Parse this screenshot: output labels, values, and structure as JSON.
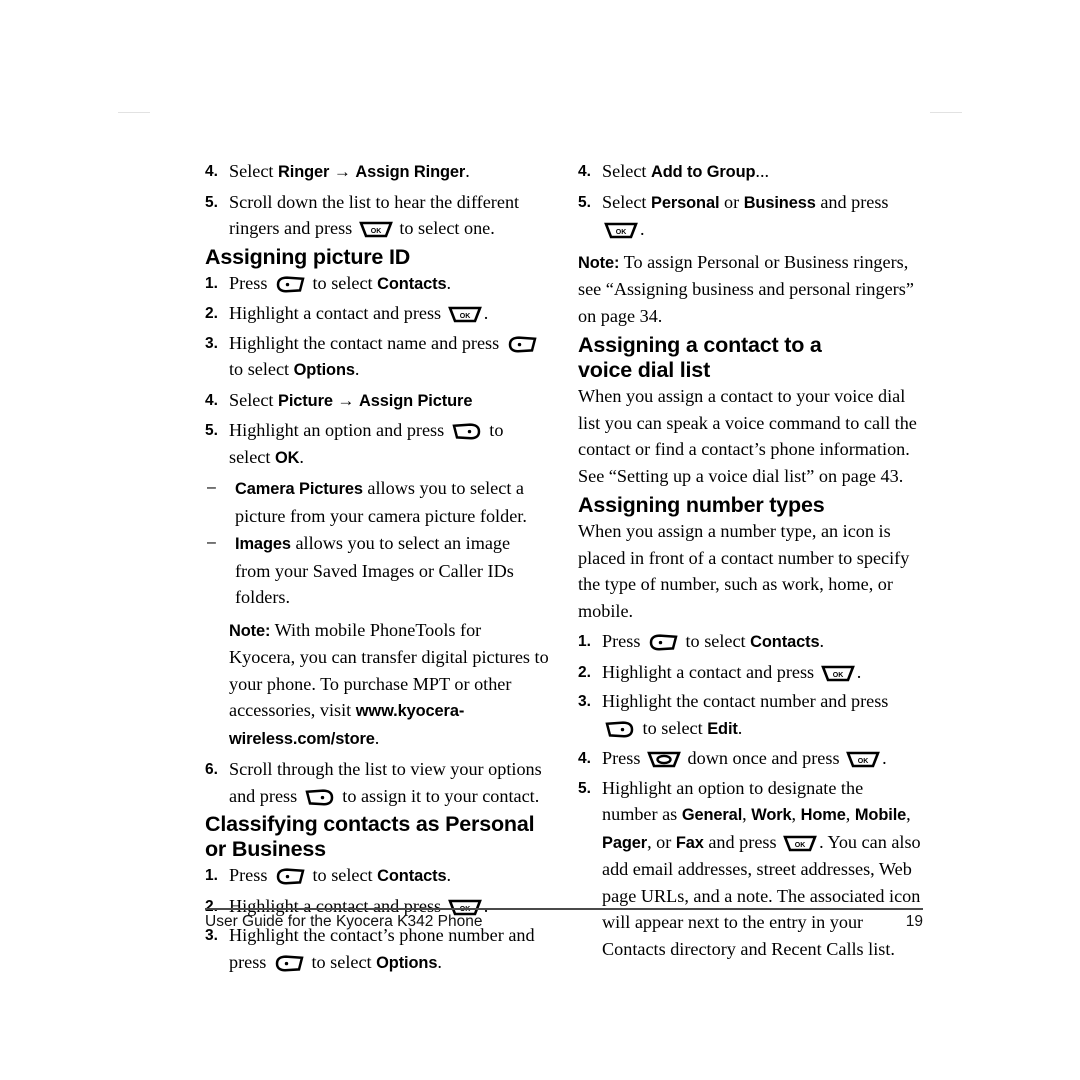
{
  "document": {
    "footer_text": "User Guide for the Kyocera K342 Phone",
    "page_number": "19"
  },
  "icons": {
    "ok_key": "ok-key-icon",
    "left_softkey": "left-softkey-icon",
    "right_softkey": "right-softkey-icon",
    "navigation_key": "navigation-key-icon",
    "arrow": "→",
    "dash": "–"
  },
  "left_column": {
    "continued_steps": [
      {
        "num": "4.",
        "parts": [
          {
            "t": "text",
            "v": "Select "
          },
          {
            "t": "ui",
            "v": "Ringer"
          },
          {
            "t": "text",
            "v": " "
          },
          {
            "t": "arrow",
            "v": "→"
          },
          {
            "t": "text",
            "v": " "
          },
          {
            "t": "ui",
            "v": "Assign Ringer"
          },
          {
            "t": "text",
            "v": "."
          }
        ]
      },
      {
        "num": "5.",
        "parts": [
          {
            "t": "text",
            "v": "Scroll down the list to hear the different ringers and press "
          },
          {
            "t": "icon",
            "v": "ok_key"
          },
          {
            "t": "text",
            "v": " to select one."
          }
        ]
      }
    ],
    "section_picture_id": {
      "heading": "Assigning picture ID",
      "steps": [
        {
          "num": "1.",
          "parts": [
            {
              "t": "text",
              "v": "Press "
            },
            {
              "t": "icon",
              "v": "left_softkey"
            },
            {
              "t": "text",
              "v": " to select "
            },
            {
              "t": "ui",
              "v": "Contacts"
            },
            {
              "t": "text",
              "v": "."
            }
          ]
        },
        {
          "num": "2.",
          "parts": [
            {
              "t": "text",
              "v": "Highlight a contact and press "
            },
            {
              "t": "icon",
              "v": "ok_key"
            },
            {
              "t": "text",
              "v": "."
            }
          ]
        },
        {
          "num": "3.",
          "parts": [
            {
              "t": "text",
              "v": "Highlight the contact name and press "
            },
            {
              "t": "icon",
              "v": "left_softkey"
            },
            {
              "t": "text",
              "v": " to select "
            },
            {
              "t": "ui",
              "v": "Options"
            },
            {
              "t": "text",
              "v": "."
            }
          ]
        },
        {
          "num": "4.",
          "parts": [
            {
              "t": "text",
              "v": "Select "
            },
            {
              "t": "ui",
              "v": "Picture"
            },
            {
              "t": "text",
              "v": " "
            },
            {
              "t": "arrow",
              "v": "→"
            },
            {
              "t": "text",
              "v": " "
            },
            {
              "t": "ui",
              "v": "Assign Picture"
            }
          ]
        },
        {
          "num": "5.",
          "parts": [
            {
              "t": "text",
              "v": "Highlight an option and press "
            },
            {
              "t": "icon",
              "v": "right_softkey"
            },
            {
              "t": "text",
              "v": " to select "
            },
            {
              "t": "ui",
              "v": "OK"
            },
            {
              "t": "text",
              "v": "."
            }
          ]
        }
      ],
      "sub_items": [
        {
          "dash": "–",
          "parts": [
            {
              "t": "ui",
              "v": "Camera Pictures"
            },
            {
              "t": "text",
              "v": " allows you to select a picture from your camera picture folder."
            }
          ]
        },
        {
          "dash": "–",
          "parts": [
            {
              "t": "ui",
              "v": "Images"
            },
            {
              "t": "text",
              "v": " allows you to select an image from your Saved Images or Caller IDs folders."
            }
          ]
        }
      ],
      "note": {
        "label": "Note:",
        "parts": [
          {
            "t": "text",
            "v": "  With mobile PhoneTools for Kyocera, you can transfer digital pictures to your phone. To purchase MPT or other accessories, visit "
          },
          {
            "t": "ui",
            "v": "www.kyocera-wireless.com/store"
          },
          {
            "t": "text",
            "v": "."
          }
        ]
      },
      "final_step": {
        "num": "6.",
        "parts": [
          {
            "t": "text",
            "v": "Scroll through the list to view your options and press "
          },
          {
            "t": "icon",
            "v": "right_softkey"
          },
          {
            "t": "text",
            "v": " to assign it to your contact."
          }
        ]
      }
    },
    "section_classifying": {
      "heading": "Classifying contacts as Personal or Business",
      "steps": [
        {
          "num": "1.",
          "parts": [
            {
              "t": "text",
              "v": "Press "
            },
            {
              "t": "icon",
              "v": "left_softkey"
            },
            {
              "t": "text",
              "v": " to select "
            },
            {
              "t": "ui",
              "v": "Contacts"
            },
            {
              "t": "text",
              "v": "."
            }
          ]
        },
        {
          "num": "2.",
          "parts": [
            {
              "t": "text",
              "v": "Highlight a contact and press "
            },
            {
              "t": "icon",
              "v": "ok_key"
            },
            {
              "t": "text",
              "v": "."
            }
          ]
        },
        {
          "num": "3.",
          "parts": [
            {
              "t": "text",
              "v": "Highlight the contact’s phone number and press "
            },
            {
              "t": "icon",
              "v": "left_softkey"
            },
            {
              "t": "text",
              "v": " to select "
            },
            {
              "t": "ui",
              "v": "Options"
            },
            {
              "t": "text",
              "v": "."
            }
          ]
        }
      ]
    }
  },
  "right_column": {
    "continued_steps": [
      {
        "num": "4.",
        "parts": [
          {
            "t": "text",
            "v": "Select "
          },
          {
            "t": "ui",
            "v": "Add to Group"
          },
          {
            "t": "text",
            "v": "..."
          }
        ]
      },
      {
        "num": "5.",
        "parts": [
          {
            "t": "text",
            "v": "Select "
          },
          {
            "t": "ui",
            "v": "Personal"
          },
          {
            "t": "text",
            "v": " or "
          },
          {
            "t": "ui",
            "v": "Business"
          },
          {
            "t": "text",
            "v": " and press "
          },
          {
            "t": "icon",
            "v": "ok_key"
          },
          {
            "t": "text",
            "v": "."
          }
        ]
      }
    ],
    "note": {
      "label": "Note:",
      "parts": [
        {
          "t": "text",
          "v": "  To assign Personal or Business ringers, see “Assigning business and personal ringers” on page 34."
        }
      ]
    },
    "section_voice_dial": {
      "heading_line1": "Assigning a contact to a",
      "heading_line2": "voice dial list",
      "paragraph": "When you assign a contact to your voice dial list you can speak a voice command to call the contact or find a contact’s phone information. See “Setting up a voice dial list” on page 43."
    },
    "section_number_types": {
      "heading": "Assigning number types",
      "paragraph": "When you assign a number type, an icon is placed in front of a contact number to specify the type of number, such as work, home, or mobile.",
      "steps": [
        {
          "num": "1.",
          "parts": [
            {
              "t": "text",
              "v": "Press "
            },
            {
              "t": "icon",
              "v": "left_softkey"
            },
            {
              "t": "text",
              "v": " to select "
            },
            {
              "t": "ui",
              "v": "Contacts"
            },
            {
              "t": "text",
              "v": "."
            }
          ]
        },
        {
          "num": "2.",
          "parts": [
            {
              "t": "text",
              "v": "Highlight a contact and press "
            },
            {
              "t": "icon",
              "v": "ok_key"
            },
            {
              "t": "text",
              "v": "."
            }
          ]
        },
        {
          "num": "3.",
          "parts": [
            {
              "t": "text",
              "v": "Highlight the contact number and press "
            },
            {
              "t": "icon",
              "v": "right_softkey"
            },
            {
              "t": "text",
              "v": " to select "
            },
            {
              "t": "ui",
              "v": "Edit"
            },
            {
              "t": "text",
              "v": "."
            }
          ]
        },
        {
          "num": "4.",
          "parts": [
            {
              "t": "text",
              "v": "Press "
            },
            {
              "t": "icon",
              "v": "navigation_key"
            },
            {
              "t": "text",
              "v": " down once and press "
            },
            {
              "t": "icon",
              "v": "ok_key"
            },
            {
              "t": "text",
              "v": "."
            }
          ]
        },
        {
          "num": "5.",
          "parts": [
            {
              "t": "text",
              "v": "Highlight an option to designate the number as "
            },
            {
              "t": "ui",
              "v": "General"
            },
            {
              "t": "text",
              "v": ", "
            },
            {
              "t": "ui",
              "v": "Work"
            },
            {
              "t": "text",
              "v": ", "
            },
            {
              "t": "ui",
              "v": "Home"
            },
            {
              "t": "text",
              "v": ", "
            },
            {
              "t": "ui",
              "v": "Mobile"
            },
            {
              "t": "text",
              "v": ", "
            },
            {
              "t": "ui",
              "v": "Pager"
            },
            {
              "t": "text",
              "v": ", or "
            },
            {
              "t": "ui",
              "v": "Fax"
            },
            {
              "t": "text",
              "v": " and press "
            },
            {
              "t": "icon",
              "v": "ok_key"
            },
            {
              "t": "text",
              "v": ". You can also add email addresses, street addresses, Web page URLs, and a note. The associated icon will appear next to the entry in your Contacts directory and Recent Calls list."
            }
          ]
        }
      ]
    }
  }
}
